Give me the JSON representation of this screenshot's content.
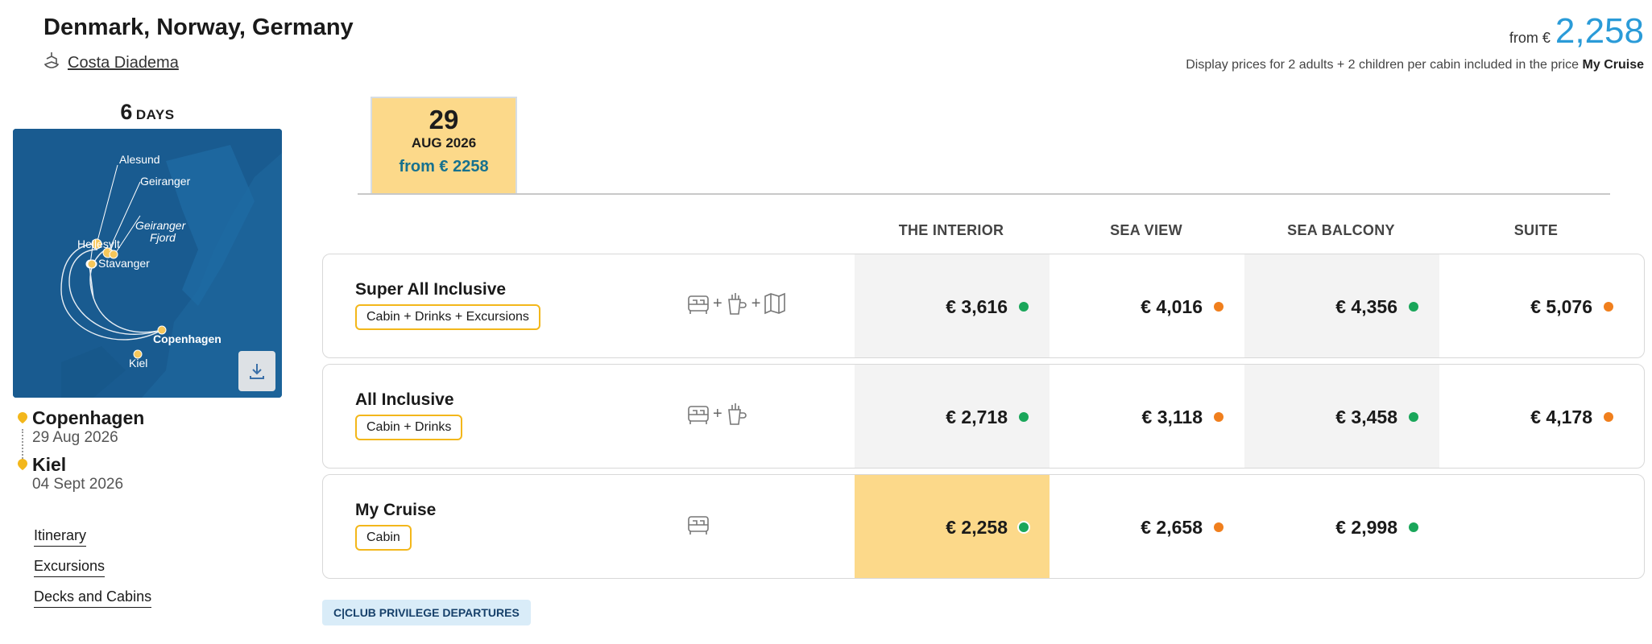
{
  "header": {
    "title": "Denmark, Norway, Germany",
    "ship_name": "Costa Diadema",
    "from_label": "from €",
    "price": "2,258",
    "display_note_prefix": "Display prices for 2 adults + 2 children per cabin included in the price",
    "display_note_bold": "My Cruise"
  },
  "trip": {
    "days_number": "6",
    "days_label": "DAYS"
  },
  "map": {
    "labels": [
      "Alesund",
      "Geiranger",
      "Geiranger",
      "Fjord",
      "Hellesylt",
      "Stavanger",
      "Copenhagen",
      "Kiel"
    ]
  },
  "stops": [
    {
      "city": "Copenhagen",
      "date": "29 Aug 2026"
    },
    {
      "city": "Kiel",
      "date": "04 Sept 2026"
    }
  ],
  "links": [
    "Itinerary",
    "Excursions",
    "Decks and Cabins"
  ],
  "date_tab": {
    "day": "29",
    "month_year": "AUG 2026",
    "price": "from € 2258"
  },
  "columns": [
    "THE INTERIOR",
    "SEA VIEW",
    "SEA BALCONY",
    "SUITE"
  ],
  "rows": [
    {
      "name": "Super All Inclusive",
      "badge": "Cabin + Drinks + Excursions",
      "icons": [
        "bed-icon",
        "drink-icon",
        "map-icon"
      ],
      "prices": [
        "€ 3,616",
        "€ 4,016",
        "€ 4,356",
        "€ 5,076"
      ],
      "dots": [
        "green",
        "orange",
        "green",
        "orange"
      ]
    },
    {
      "name": "All Inclusive",
      "badge": "Cabin + Drinks",
      "icons": [
        "bed-icon",
        "drink-icon"
      ],
      "prices": [
        "€ 2,718",
        "€ 3,118",
        "€ 3,458",
        "€ 4,178"
      ],
      "dots": [
        "green",
        "orange",
        "green",
        "orange"
      ]
    },
    {
      "name": "My Cruise",
      "badge": "Cabin",
      "icons": [
        "bed-icon"
      ],
      "prices": [
        "€ 2,258",
        "€ 2,658",
        "€ 2,998",
        ""
      ],
      "dots": [
        "green",
        "orange",
        "green",
        ""
      ]
    }
  ],
  "plus_sign": "+",
  "colors": {
    "green": "#1aa65a",
    "orange": "#f07f1d",
    "accent_blue": "#2a9bd8",
    "highlight": "#fcd98a"
  },
  "cclub_label": "C|CLUB PRIVILEGE DEPARTURES"
}
